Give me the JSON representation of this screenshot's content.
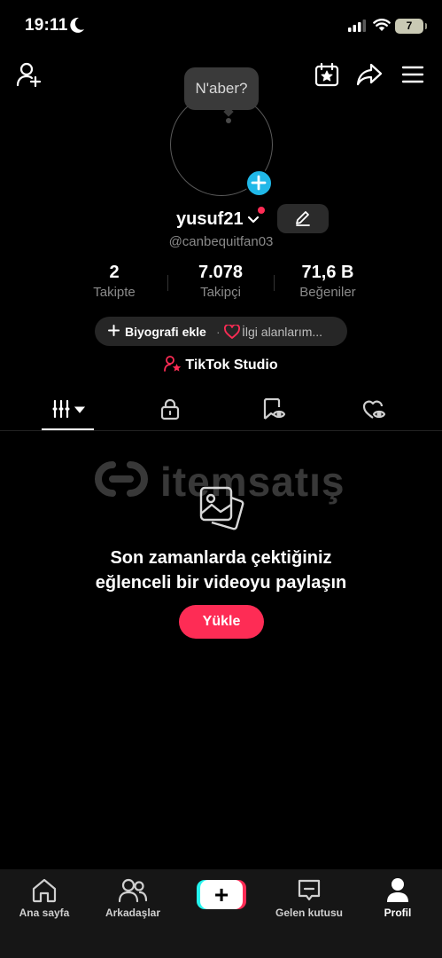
{
  "status_bar": {
    "time": "19:11",
    "battery": "7"
  },
  "profile": {
    "bubble_text": "N'aber?",
    "username": "yusuf21",
    "handle": "@canbequitfan03"
  },
  "stats": [
    {
      "value": "2",
      "label": "Takipte"
    },
    {
      "value": "7.078",
      "label": "Takipçi"
    },
    {
      "value": "71,6 B",
      "label": "Beğeniler"
    }
  ],
  "bio": {
    "add_bio": "Biyografi ekle",
    "separator": "·",
    "interests": "İlgi alanlarım..."
  },
  "studio_label": "TikTok Studio",
  "watermark_text": "itemsatış",
  "empty_state": {
    "line1": "Son zamanlarda çektiğiniz",
    "line2": "eğlenceli bir videoyu paylaşın",
    "button": "Yükle"
  },
  "bottom_nav": [
    {
      "label": "Ana sayfa"
    },
    {
      "label": "Arkadaşlar"
    },
    {
      "label": ""
    },
    {
      "label": "Gelen kutusu"
    },
    {
      "label": "Profil"
    }
  ],
  "plus_symbol": "+",
  "colors": {
    "accent": "#fe2c55",
    "avatar_add": "#20b8e8",
    "cyan": "#25f4ee"
  }
}
